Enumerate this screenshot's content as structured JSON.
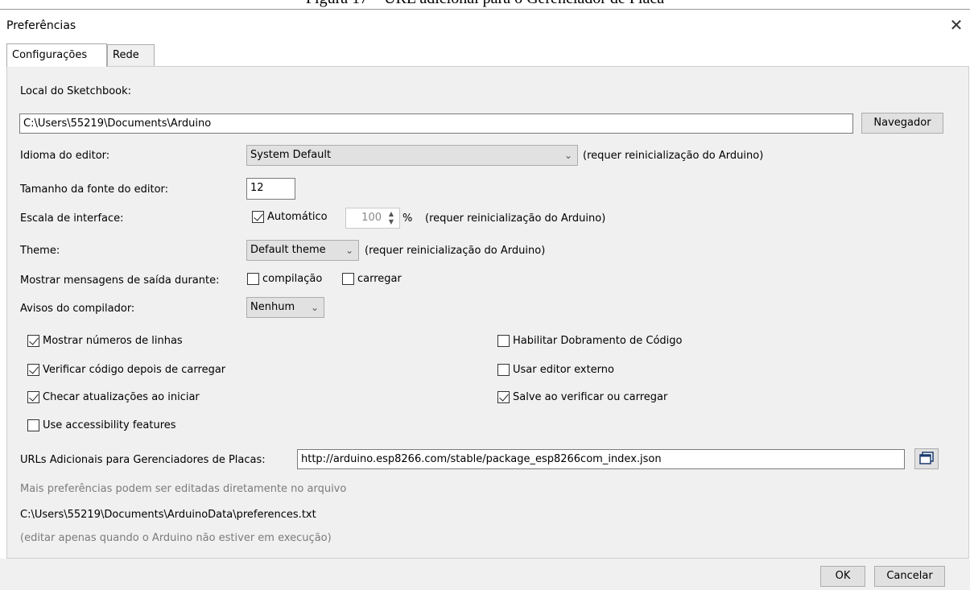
{
  "caption": "Figura 17 – URL adicional para o Gerenciador de Placa",
  "window": {
    "title": "Preferências",
    "close_glyph": "✕"
  },
  "tabs": [
    {
      "label": "Configurações",
      "active": true
    },
    {
      "label": "Rede",
      "active": false
    }
  ],
  "sketchbook": {
    "label": "Local do Sketchbook:",
    "path": "C:\\Users\\55219\\Documents\\Arduino",
    "browse_label": "Navegador"
  },
  "language": {
    "label": "Idioma do editor:",
    "value": "System Default",
    "note": "(requer reinicialização do Arduino)"
  },
  "font_size": {
    "label": "Tamanho da fonte do editor:",
    "value": "12"
  },
  "scale": {
    "label": "Escala de interface:",
    "auto_label": "Automático",
    "auto_checked": true,
    "value": "100",
    "unit": "%",
    "note": "(requer reinicialização do Arduino)"
  },
  "theme": {
    "label": "Theme:",
    "value": "Default theme",
    "note": "(requer reinicialização do Arduino)"
  },
  "verbose": {
    "label": "Mostrar mensagens de saída durante:",
    "compile_label": "compilação",
    "compile_checked": false,
    "upload_label": "carregar",
    "upload_checked": false
  },
  "warnings": {
    "label": "Avisos do compilador:",
    "value": "Nenhum"
  },
  "options_left": [
    {
      "label": "Mostrar números de linhas",
      "checked": true
    },
    {
      "label": "Verificar código depois de carregar",
      "checked": true
    },
    {
      "label": "Checar atualizações ao iniciar",
      "checked": true
    },
    {
      "label": "Use accessibility features",
      "checked": false
    }
  ],
  "options_right": [
    {
      "label": "Habilitar Dobramento de Código",
      "checked": false
    },
    {
      "label": "Usar editor externo",
      "checked": false
    },
    {
      "label": "Salve ao verificar ou carregar",
      "checked": true
    }
  ],
  "boards_url": {
    "label": "URLs Adicionais para Gerenciadores de Placas:",
    "value": "http://arduino.esp8266.com/stable/package_esp8266com_index.json"
  },
  "prefs_file": {
    "hint": "Mais preferências podem ser editadas diretamente no arquivo",
    "path": "C:\\Users\\55219\\Documents\\ArduinoData\\preferences.txt",
    "note": "(editar apenas quando o Arduino não estiver em execução)"
  },
  "footer": {
    "ok_label": "OK",
    "cancel_label": "Cancelar"
  }
}
